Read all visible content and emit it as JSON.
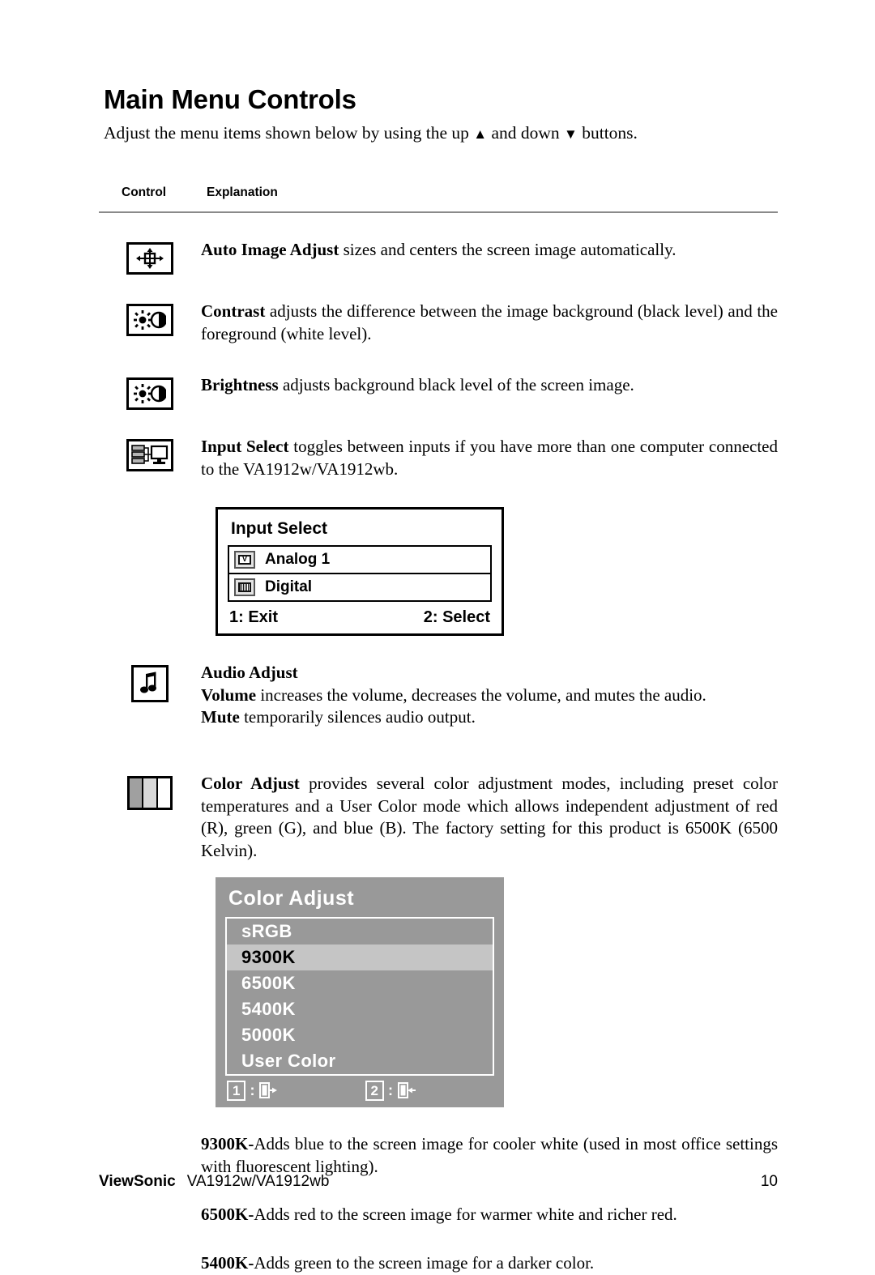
{
  "document": {
    "title": "Main Menu Controls",
    "intro_before": "Adjust the menu items shown below by using the up ",
    "intro_mid": " and down ",
    "intro_after": " buttons.",
    "up_arrow": "▲",
    "down_arrow": "▼"
  },
  "table_header": {
    "control": "Control",
    "explanation": "Explanation"
  },
  "controls": [
    {
      "icon": "auto-image-adjust-icon",
      "term": "Auto Image Adjust",
      "description": " sizes and centers the screen image automatically."
    },
    {
      "icon": "contrast-icon",
      "term": "Contrast",
      "description": " adjusts the difference between the image background  (black level) and the foreground (white level)."
    },
    {
      "icon": "brightness-icon",
      "term": "Brightness",
      "description": " adjusts background black level of the screen image."
    },
    {
      "icon": "input-select-icon",
      "term": "Input Select",
      "description": " toggles between inputs if you have more than one computer connected to the VA1912w/VA1912wb."
    }
  ],
  "audio_adjust": {
    "icon": "music-note-icon",
    "heading": "Audio Adjust",
    "volume_term": "Volume",
    "volume_text": " increases the volume, decreases the volume, and mutes the audio.",
    "mute_term": "Mute",
    "mute_text": " temporarily silences audio output."
  },
  "color_adjust": {
    "icon": "color-bars-icon",
    "term": "Color Adjust",
    "description": " provides several color adjustment modes, including preset color temperatures and a User Color mode which allows independent adjustment of red (R), green (G), and blue (B). The factory setting for this product is 6500K (6500 Kelvin)."
  },
  "osd_input_select": {
    "title": "Input Select",
    "items": [
      {
        "label": "Analog 1",
        "icon": "monitor-analog-icon",
        "glyph": "V"
      },
      {
        "label": "Digital",
        "icon": "monitor-digital-icon",
        "glyph": ""
      }
    ],
    "footer_left": "1: Exit",
    "footer_right": "2: Select"
  },
  "osd_color_adjust": {
    "title": "Color Adjust",
    "background_color": "#999999",
    "highlight_color": "#c5c5c5",
    "items": [
      {
        "label": "sRGB",
        "selected": false
      },
      {
        "label": "9300K",
        "selected": true
      },
      {
        "label": "6500K",
        "selected": false
      },
      {
        "label": "5400K",
        "selected": false
      },
      {
        "label": "5000K",
        "selected": false
      },
      {
        "label": "User Color",
        "selected": false
      }
    ],
    "footer": [
      {
        "key": "1",
        "separator": ":",
        "icon": "exit-door-icon"
      },
      {
        "key": "2",
        "separator": ":",
        "icon": "enter-door-icon"
      }
    ]
  },
  "temperature_notes": [
    {
      "term": "9300K-",
      "text": "Adds blue to the screen image for cooler white (used in most office settings with fluorescent lighting)."
    },
    {
      "term": "6500K-",
      "text": "Adds red to the screen image for warmer white and richer red."
    },
    {
      "term": "5400K-",
      "text": "Adds green to the screen image for a darker color."
    }
  ],
  "footer": {
    "brand": "ViewSonic",
    "model": "VA1912w/VA1912wb",
    "page_number": "10"
  }
}
